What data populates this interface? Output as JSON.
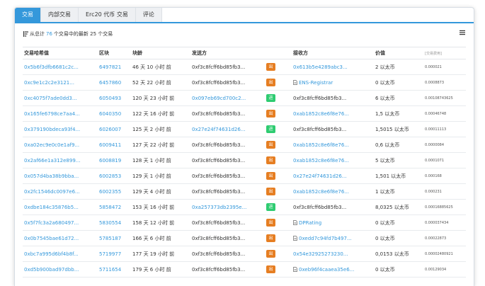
{
  "tabs": [
    "交易",
    "内部交易",
    "Erc20 代币 交易",
    "评论"
  ],
  "summary": {
    "prefix": "从总计",
    "total": "76",
    "suffix": "个交易中的最新 25 个交易"
  },
  "table": {
    "headers": [
      "交易哈希值",
      "区块",
      "块龄",
      "发送方",
      "",
      "接收方",
      "价值",
      "[交易费用]"
    ],
    "rows": [
      {
        "hash": "0x5b6f3dfb6681c2c...",
        "block": "6497821",
        "age": "46 天 10 小时 前",
        "from": "0xf3c8fcff6bd85fb3...",
        "dir": "出",
        "dir_type": "out",
        "to": "0x613b5e4289abc3...",
        "to_type": "link",
        "value": "2 以太币",
        "fee": "0.000021"
      },
      {
        "hash": "0xc9e1c2c2e3121...",
        "block": "6457860",
        "age": "52 天 22 小时 前",
        "from": "0xf3c8fcff6bd85fb3...",
        "dir": "出",
        "dir_type": "out",
        "to": "ENS-Registrar",
        "to_type": "contract",
        "value": "0 以太币",
        "fee": "0.0008873"
      },
      {
        "hash": "0xc4075f7ade0dd3...",
        "block": "6050493",
        "age": "120 天 23 小时 前",
        "from": "0x097eb69cd700c2...",
        "dir": "进",
        "dir_type": "in",
        "to": "0xf3c8fcff6bd85fb3...",
        "to_type": "plain",
        "value": "6 以太币",
        "fee": "0.00108743625"
      },
      {
        "hash": "0x165fe6798ce7aa4...",
        "block": "6040350",
        "age": "122 天 16 小时 前",
        "from": "0xf3c8fcff6bd85fb3...",
        "dir": "出",
        "dir_type": "out",
        "to": "0xab1852c8e6f8e76...",
        "to_type": "link",
        "value": "1,5 以太币",
        "fee": "0.00046748"
      },
      {
        "hash": "0x379190bdeca93f4...",
        "block": "6026007",
        "age": "125 天 2 小时 前",
        "from": "0x27e24f74631d26...",
        "dir": "进",
        "dir_type": "in",
        "to": "0xf3c8fcff6bd85fb3...",
        "to_type": "plain",
        "value": "1,5015 以太币",
        "fee": "0.00011113"
      },
      {
        "hash": "0xa02ec9e0c0e1af9...",
        "block": "6009411",
        "age": "127 天 22 小时 前",
        "from": "0xf3c8fcff6bd85fb3...",
        "dir": "出",
        "dir_type": "out",
        "to": "0xab1852c8e6f8e76...",
        "to_type": "link",
        "value": "0,6 以太币",
        "fee": "0.0000084"
      },
      {
        "hash": "0x2af66e1a312e899...",
        "block": "6008819",
        "age": "128 天 1 小时 前",
        "from": "0xf3c8fcff6bd85fb3...",
        "dir": "出",
        "dir_type": "out",
        "to": "0xab1852c8e6f8e76...",
        "to_type": "link",
        "value": "5 以太币",
        "fee": "0.0001071"
      },
      {
        "hash": "0x057d4ba38b9bba...",
        "block": "6002853",
        "age": "129 天 1 小时 前",
        "from": "0xf3c8fcff6bd85fb3...",
        "dir": "出",
        "dir_type": "out",
        "to": "0x27e24f74631d26...",
        "to_type": "link",
        "value": "1,501 以太币",
        "fee": "0.000168"
      },
      {
        "hash": "0x2fc1546dc0097e6...",
        "block": "6002355",
        "age": "129 天 4 小时 前",
        "from": "0xf3c8fcff6bd85fb3...",
        "dir": "出",
        "dir_type": "out",
        "to": "0xab1852c8e6f8e76...",
        "to_type": "link",
        "value": "1 以太币",
        "fee": "0.000231"
      },
      {
        "hash": "0xdbe184c35876b5...",
        "block": "5858472",
        "age": "153 天 16 小时 前",
        "from": "0xa257373db2395e...",
        "dir": "进",
        "dir_type": "in",
        "to": "0xf3c8fcff6bd85fb3...",
        "to_type": "plain",
        "value": "8,0325 以太币",
        "fee": "0.00016885625"
      },
      {
        "hash": "0x5f7fc3a2a680497...",
        "block": "5830554",
        "age": "158 天 12 小时 前",
        "from": "0xf3c8fcff6bd85fb3...",
        "dir": "出",
        "dir_type": "out",
        "to": "DPRating",
        "to_type": "contract",
        "value": "0 以太币",
        "fee": "0.000037434"
      },
      {
        "hash": "0x0b7545bae61d72...",
        "block": "5785187",
        "age": "166 天 6 小时 前",
        "from": "0xf3c8fcff6bd85fb3...",
        "dir": "出",
        "dir_type": "out",
        "to": "0xedd7c94fd7b497...",
        "to_type": "contract",
        "value": "0 以太币",
        "fee": "0.00022873"
      },
      {
        "hash": "0xbc7a995d6bf4b8f...",
        "block": "5719977",
        "age": "177 天 19 小时 前",
        "from": "0xf3c8fcff6bd85fb3...",
        "dir": "出",
        "dir_type": "out",
        "to": "0x54e32925273230...",
        "to_type": "link",
        "value": "0,0153 以太币",
        "fee": "0.00002480921"
      },
      {
        "hash": "0xd5b900bad97dbb...",
        "block": "5711654",
        "age": "179 天 6 小时 前",
        "from": "0xf3c8fcff6bd85fb3...",
        "dir": "出",
        "dir_type": "out",
        "to": "0xeb96f4caaea35e6...",
        "to_type": "contract",
        "value": "0 以太币",
        "fee": "0.00129034"
      }
    ]
  },
  "colors": {
    "accent": "#3498db",
    "out_badge": "#e67e22",
    "in_badge": "#2ecc71"
  },
  "icons": {
    "sort": "sort-icon",
    "menu": "menu-icon",
    "contract": "document-icon"
  }
}
